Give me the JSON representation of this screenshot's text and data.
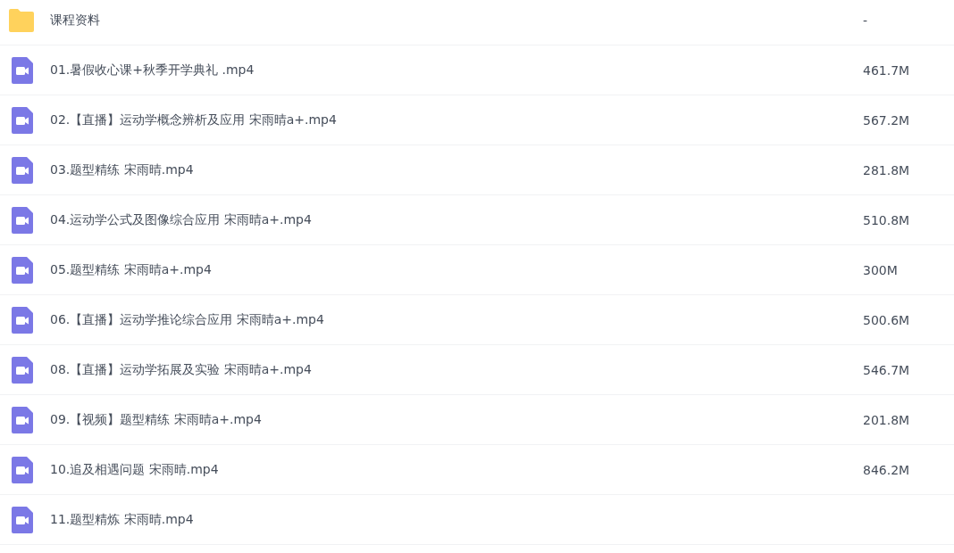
{
  "files": [
    {
      "kind": "folder",
      "name": "课程资料",
      "size": "-"
    },
    {
      "kind": "video",
      "name": "01.暑假收心课+秋季开学典礼 .mp4",
      "size": "461.7M"
    },
    {
      "kind": "video",
      "name": "02.【直播】运动学概念辨析及应用 宋雨晴a+.mp4",
      "size": "567.2M"
    },
    {
      "kind": "video",
      "name": "03.题型精练 宋雨晴.mp4",
      "size": "281.8M"
    },
    {
      "kind": "video",
      "name": "04.运动学公式及图像综合应用 宋雨晴a+.mp4",
      "size": "510.8M"
    },
    {
      "kind": "video",
      "name": "05.题型精练 宋雨晴a+.mp4",
      "size": "300M"
    },
    {
      "kind": "video",
      "name": "06.【直播】运动学推论综合应用 宋雨晴a+.mp4",
      "size": "500.6M"
    },
    {
      "kind": "video",
      "name": "08.【直播】运动学拓展及实验 宋雨晴a+.mp4",
      "size": "546.7M"
    },
    {
      "kind": "video",
      "name": "09.【视频】题型精练 宋雨晴a+.mp4",
      "size": "201.8M"
    },
    {
      "kind": "video",
      "name": "10.追及相遇问题 宋雨晴.mp4",
      "size": "846.2M"
    },
    {
      "kind": "video",
      "name": "11.题型精炼 宋雨晴.mp4"
    }
  ]
}
